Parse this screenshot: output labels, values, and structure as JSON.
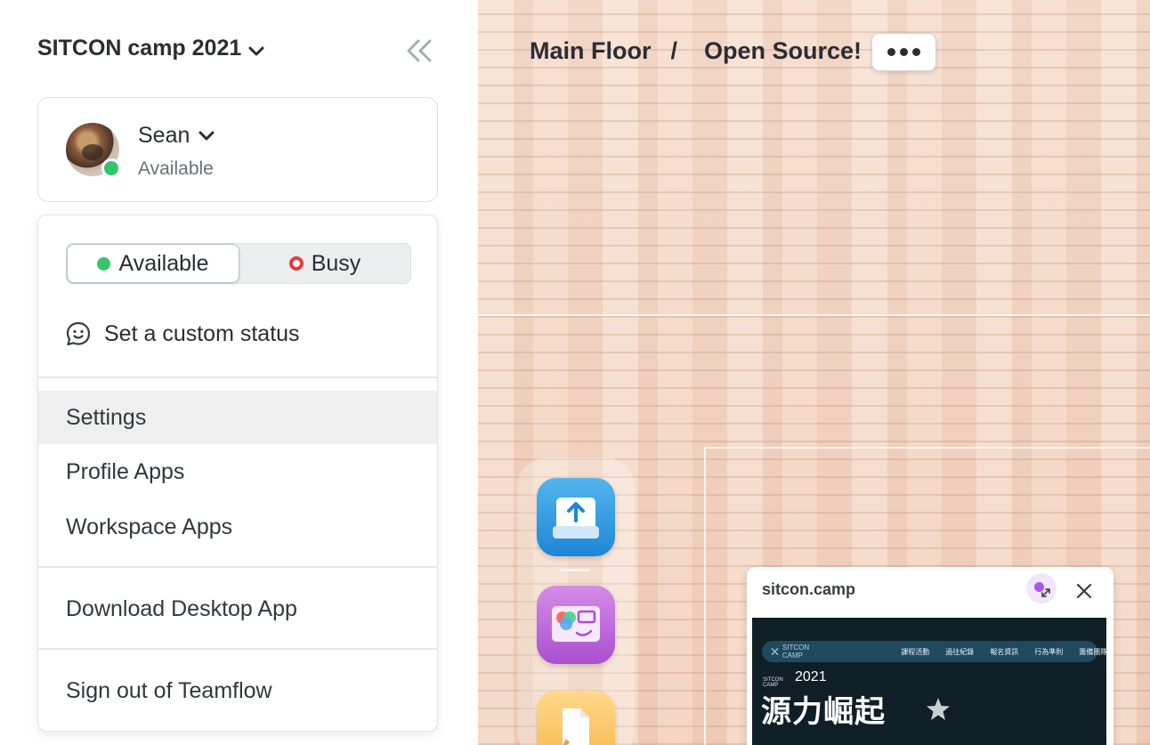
{
  "workspace": {
    "title": "SITCON camp 2021"
  },
  "user": {
    "name": "Sean",
    "status": "Available"
  },
  "status_menu": {
    "options": [
      {
        "label": "Available",
        "selected": true,
        "color": "#35c46e"
      },
      {
        "label": "Busy",
        "selected": false,
        "color": "#e23d3d"
      }
    ],
    "custom_status_label": "Set a custom status",
    "items": [
      {
        "label": "Settings",
        "hovered": true
      },
      {
        "label": "Profile Apps"
      },
      {
        "label": "Workspace Apps"
      },
      {
        "label": "Download Desktop App"
      },
      {
        "label": "Sign out of Teamflow"
      }
    ]
  },
  "breadcrumb": {
    "floor": "Main Floor",
    "separator": "/",
    "room": "Open Source!"
  },
  "dock": {
    "apps": [
      "upload-app-icon",
      "whiteboard-app-icon",
      "notes-app-icon"
    ]
  },
  "browser_card": {
    "url": "sitcon.camp",
    "site": {
      "logo_text": "SITCON CAMP",
      "nav": [
        "課程活動",
        "過往紀錄",
        "報名資訊",
        "行為準則",
        "籌備團隊"
      ],
      "year": "2021",
      "year_prefix": "SITCON CAMP",
      "headline": "源力崛起"
    }
  },
  "colors": {
    "accent_green": "#35c46e",
    "busy_red": "#e23d3d",
    "site_bg": "#0f1f26"
  }
}
